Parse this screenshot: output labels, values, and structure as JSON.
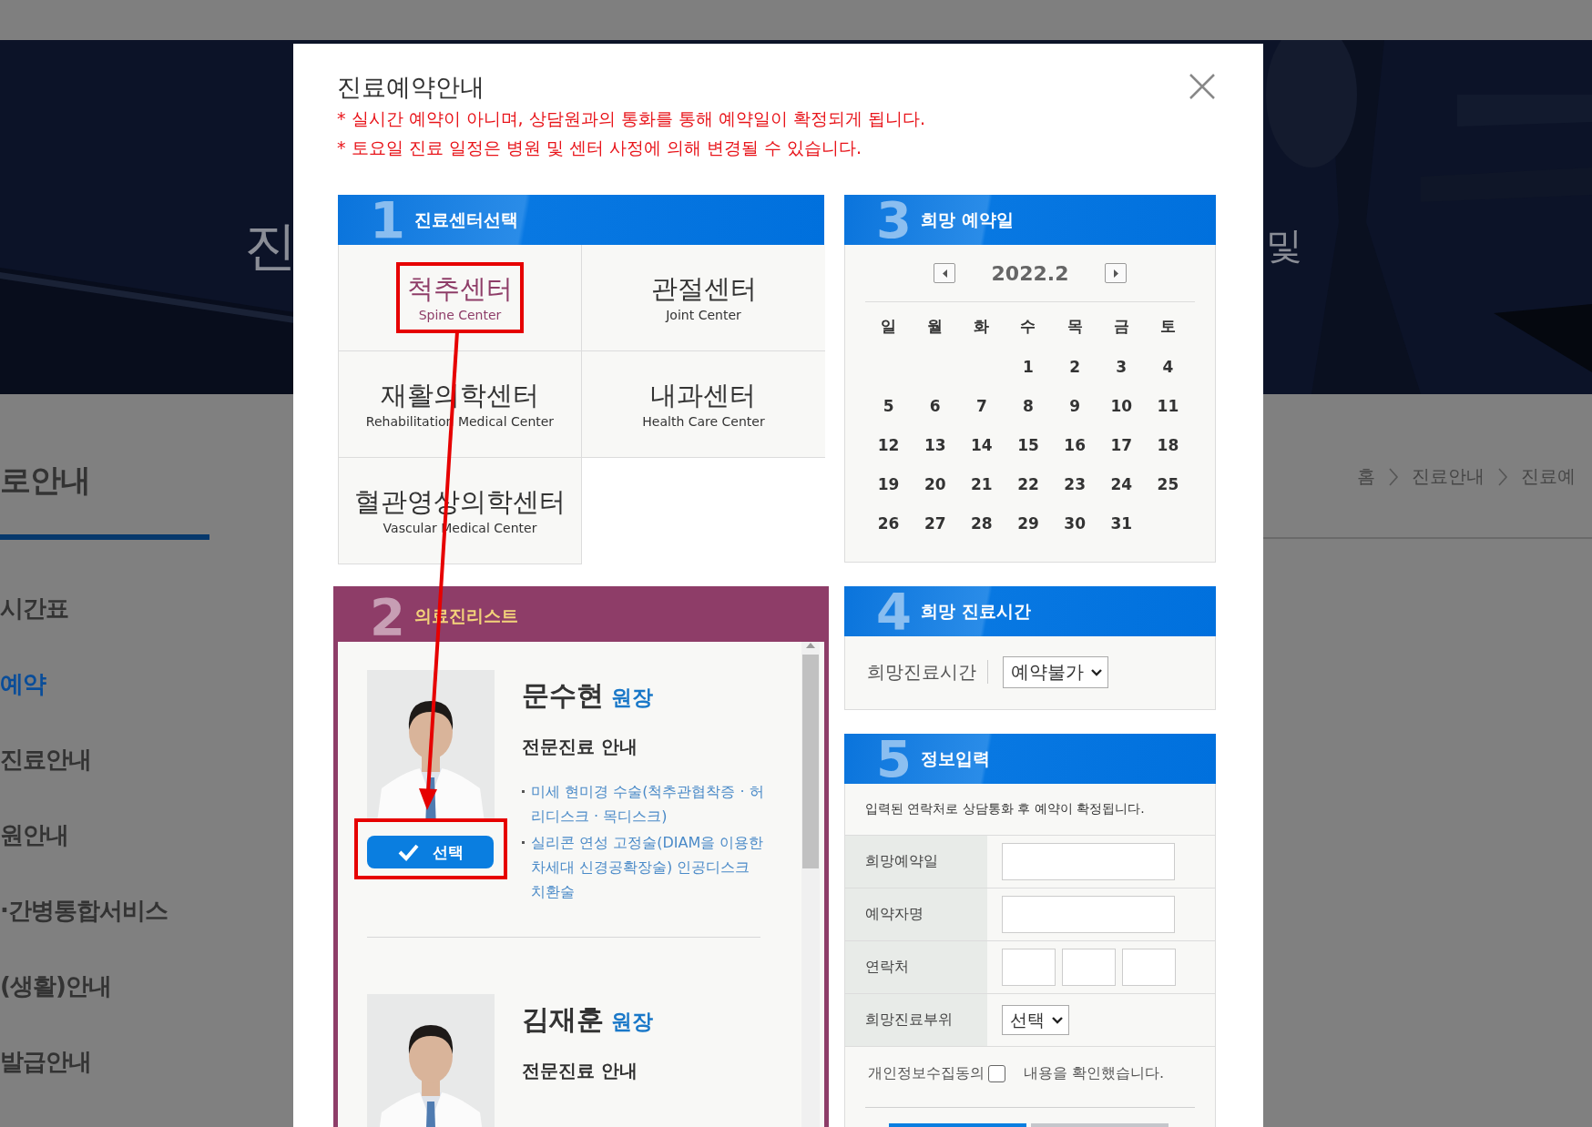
{
  "page": {
    "hero": {
      "left_text": "진",
      "right_text": "및"
    },
    "sidebar": {
      "title": "로안내",
      "items": [
        {
          "label": "시간표",
          "selected": false
        },
        {
          "label": "예약",
          "selected": true
        },
        {
          "label": "진료안내",
          "selected": false
        },
        {
          "label": "원안내",
          "selected": false
        },
        {
          "label": "·간병통합서비스",
          "selected": false
        },
        {
          "label": "(생활)안내",
          "selected": false
        },
        {
          "label": "발급안내",
          "selected": false
        }
      ]
    },
    "breadcrumb": [
      "홈",
      "진료안내",
      "진료예"
    ]
  },
  "modal": {
    "title": "진료예약안내",
    "notices": [
      "* 실시간 예약이 아니며, 상담원과의 통화를 통해 예약일이 확정되게 됩니다.",
      "* 토요일 진료 일정은 병원 및 센터 사정에 의해 변경될 수 있습니다."
    ],
    "center_select": {
      "number": "1",
      "title": "진료센터선택",
      "centers": [
        {
          "name": "척추센터",
          "english": "Spine Center",
          "selected": true,
          "highlighted": true
        },
        {
          "name": "관절센터",
          "english": "Joint Center",
          "selected": false,
          "highlighted": false
        },
        {
          "name": "재활의학센터",
          "english": "Rehabilitation Medical Center",
          "selected": false,
          "highlighted": false
        },
        {
          "name": "내과센터",
          "english": "Health Care Center",
          "selected": false,
          "highlighted": false
        },
        {
          "name": "혈관영상의학센터",
          "english": "Vascular Medical Center",
          "selected": false,
          "highlighted": false
        }
      ]
    },
    "doctor_list": {
      "number": "2",
      "title": "의료진리스트",
      "doctors": [
        {
          "name": "문수현",
          "position": "원장",
          "specialty_heading": "전문진료 안내",
          "specialties": [
            "미세 현미경 수술(척추관협착증 · 허리디스크 · 목디스크)",
            "실리콘 연성 고정술(DIAM을 이용한 차세대 신경공확장술) 인공디스크 치환술"
          ],
          "select_button": "선택",
          "highlighted": true
        },
        {
          "name": "김재훈",
          "position": "원장",
          "specialty_heading": "전문진료 안내"
        }
      ]
    },
    "date_select": {
      "number": "3",
      "title": "희망 예약일",
      "month": "2022.2",
      "weekdays": [
        "일",
        "월",
        "화",
        "수",
        "목",
        "금",
        "토"
      ],
      "weeks": [
        [
          "1",
          "2",
          "3",
          "4"
        ],
        [
          "5",
          "6",
          "7",
          "8",
          "9",
          "10",
          "11"
        ],
        [
          "12",
          "13",
          "14",
          "15",
          "16",
          "17",
          "18"
        ],
        [
          "19",
          "20",
          "21",
          "22",
          "23",
          "24",
          "25"
        ],
        [
          "26",
          "27",
          "28",
          "29",
          "30",
          "31"
        ]
      ]
    },
    "time_select": {
      "number": "4",
      "title": "희망 진료시간",
      "label": "희망진료시간",
      "value": "예약불가"
    },
    "info_form": {
      "number": "5",
      "title": "정보입력",
      "note": "입력된 연락처로 상담통화 후 예약이 확정됩니다.",
      "fields": [
        {
          "label": "희망예약일",
          "kind": "text"
        },
        {
          "label": "예약자명",
          "kind": "text"
        },
        {
          "label": "연락처",
          "kind": "phone"
        },
        {
          "label": "희망진료부위",
          "kind": "select",
          "value": "선택"
        }
      ],
      "consent": {
        "label": "개인정보수집동의",
        "checked": false,
        "text": "내용을 확인했습니다."
      }
    }
  }
}
